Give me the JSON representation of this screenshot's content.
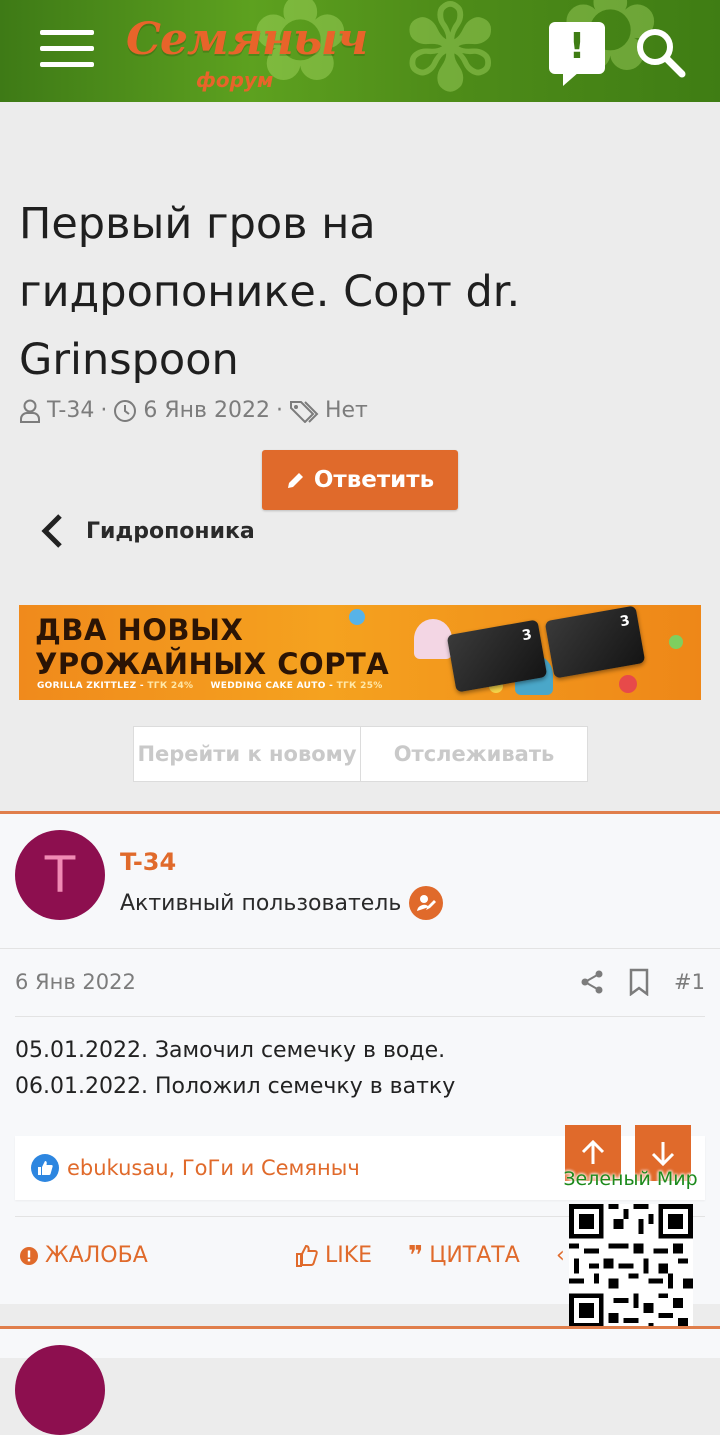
{
  "header": {
    "logo_main": "Семяныч",
    "logo_sub": "форум",
    "alert_icon": "alert-bubble-icon",
    "search_icon": "search-icon",
    "menu_icon": "hamburger-icon"
  },
  "thread": {
    "title": "Первый гров на гидропонике. Сорт dr. Grinspoon",
    "author": "T-34",
    "date": "6 Янв 2022",
    "tags": "Нет",
    "reply_label": "Ответить",
    "forum_name": "Гидропоника"
  },
  "banner": {
    "line1": "ДВА НОВЫХ",
    "line2": "УРОЖАЙНЫХ СОРТА",
    "strain1": "GORILLA ZKITTLEZ -",
    "strain1_thc": "ТГК 24%",
    "strain2": "WEDDING CAKE AUTO -",
    "strain2_thc": "ТГК 25%"
  },
  "thread_buttons": {
    "new": "Перейти к новому",
    "watch": "Отслеживать"
  },
  "post": {
    "avatar_letter": "T",
    "username": "T-34",
    "user_title": "Активный пользователь",
    "date": "6 Янв 2022",
    "number": "#1",
    "lines": [
      "05.01.2022. Замочил семечку в воде.",
      "06.01.2022. Положил семечку в ватку"
    ],
    "reactors": "ebukusau, ГоГи и Семяныч",
    "actions": {
      "report": "ЖАЛОБА",
      "like": "LIKE",
      "quote": "ЦИТАТА"
    }
  },
  "watermark": {
    "text": "Зеленый Мир"
  },
  "colors": {
    "accent": "#e06a2b",
    "header_green": "#4f8d19",
    "avatar": "#8d0f4f"
  }
}
